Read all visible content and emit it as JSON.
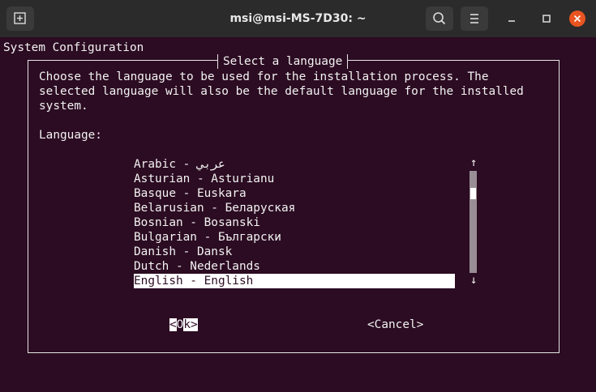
{
  "window": {
    "title": "msi@msi-MS-7D30: ~"
  },
  "terminal": {
    "header": "System Configuration",
    "dialog": {
      "title": "Select a language",
      "description": [
        "Choose the language to be used for the installation process. The",
        "selected language will also be the default language for the installed",
        "system."
      ],
      "prompt": "Language:",
      "languages": [
        "Arabic - عربي",
        "Asturian - Asturianu",
        "Basque - Euskara",
        "Belarusian - Беларуская",
        "Bosnian - Bosanski",
        "Bulgarian - Български",
        "Danish - Dansk",
        "Dutch - Nederlands",
        "English - English"
      ],
      "selected_language": "English - English",
      "scroll_up": "↑",
      "scroll_down": "↓",
      "ok_left": "<",
      "ok_hot": "O",
      "ok_rest": "k",
      "ok_right": ">",
      "cancel_label": "<Cancel>"
    }
  },
  "colors": {
    "background": "#2c0c22",
    "titlebar": "#2b2b2b",
    "close": "#e95420",
    "text": "#f2f2f2"
  }
}
